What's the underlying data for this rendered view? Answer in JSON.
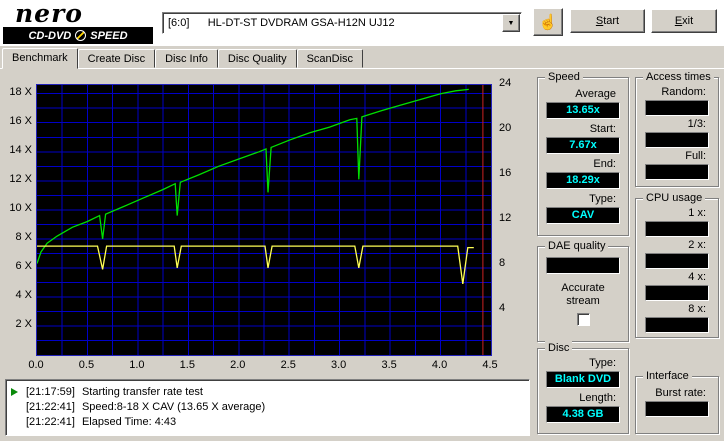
{
  "header": {
    "logo_name": "nero",
    "logo_cd_dvd": "CD-DVD",
    "logo_speed": "SPEED",
    "drive_select_value": "[6:0]      HL-DT-ST DVDRAM GSA-H12N UJ12",
    "start_button": "Start",
    "exit_button": "Exit"
  },
  "icons": {
    "dropdown_arrow": "▼",
    "hand": "☝"
  },
  "tabs": {
    "items": [
      "Benchmark",
      "Create Disc",
      "Disc Info",
      "Disc Quality",
      "ScanDisc"
    ],
    "active": "Benchmark"
  },
  "panels": {
    "speed": {
      "title": "Speed",
      "average_label": "Average",
      "average_value": "13.65x",
      "start_label": "Start:",
      "start_value": "7.67x",
      "end_label": "End:",
      "end_value": "18.29x",
      "type_label": "Type:",
      "type_value": "CAV"
    },
    "access_times": {
      "title": "Access times",
      "random_label": "Random:",
      "random_value": "",
      "one_third_label": "1/3:",
      "one_third_value": "",
      "full_label": "Full:",
      "full_value": ""
    },
    "cpu_usage": {
      "title": "CPU usage",
      "labels": [
        "1 x:",
        "2 x:",
        "4 x:",
        "8 x:"
      ],
      "values": [
        "",
        "",
        "",
        ""
      ]
    },
    "dae_quality": {
      "title": "DAE quality",
      "value": "",
      "accurate_stream_label": "Accurate stream",
      "checkbox_checked": false
    },
    "disc": {
      "title": "Disc",
      "type_label": "Type:",
      "type_value": "Blank DVD",
      "length_label": "Length:",
      "length_value": "4.38 GB"
    },
    "interface": {
      "title": "Interface",
      "burst_label": "Burst rate:",
      "burst_value": ""
    }
  },
  "log": {
    "lines": [
      {
        "time": "[21:17:59]",
        "text": "Starting transfer rate test"
      },
      {
        "time": "[21:22:41]",
        "text": "Speed:8-18 X CAV (13.65 X average)"
      },
      {
        "time": "[21:22:41]",
        "text": "Elapsed Time: 4:43"
      }
    ]
  },
  "colors": {
    "window_grey": "#d4d0c8",
    "value_cyan": "#00ffff",
    "transfer_green": "#00e000",
    "rotation_yellow": "#ffff55",
    "grid_blue": "#0000c8",
    "end_marker_red": "#cc2222"
  },
  "chart_data": {
    "type": "line",
    "x_range": [
      0,
      4.5
    ],
    "y_left_range": [
      0,
      18.6
    ],
    "y_right_range": [
      0,
      24
    ],
    "x_tick_values": [
      0,
      0.5,
      1.0,
      1.5,
      2.0,
      2.5,
      3.0,
      3.5,
      4.0,
      4.5
    ],
    "x_tick_labels": [
      "0.0",
      "0.5",
      "1.0",
      "1.5",
      "2.0",
      "2.5",
      "3.0",
      "3.5",
      "4.0",
      "4.5"
    ],
    "y_left_tick_values": [
      18,
      16,
      14,
      12,
      10,
      8,
      6,
      4,
      2
    ],
    "y_left_tick_labels": [
      "18 X",
      "16 X",
      "14 X",
      "12 X",
      "10 X",
      "8 X",
      "6 X",
      "4 X",
      "2 X"
    ],
    "y_right_tick_values": [
      24,
      20,
      16,
      12,
      8,
      4
    ],
    "y_right_tick_labels": [
      "24",
      "20",
      "16",
      "12",
      "8",
      "4"
    ],
    "grid": {
      "x_step": 0.25,
      "y_step": 1,
      "color": "#0000c8"
    },
    "end_marker_x": 4.42,
    "end_marker_color": "#cc2222",
    "series": [
      {
        "name": "transfer-rate",
        "color": "#00e000",
        "points": [
          [
            0.0,
            6.3
          ],
          [
            0.04,
            7.1
          ],
          [
            0.1,
            7.7
          ],
          [
            0.2,
            8.2
          ],
          [
            0.35,
            8.8
          ],
          [
            0.5,
            9.2
          ],
          [
            0.62,
            9.6
          ],
          [
            0.65,
            8.0
          ],
          [
            0.68,
            9.7
          ],
          [
            0.85,
            10.2
          ],
          [
            1.05,
            10.8
          ],
          [
            1.25,
            11.4
          ],
          [
            1.37,
            11.8
          ],
          [
            1.39,
            9.6
          ],
          [
            1.42,
            11.9
          ],
          [
            1.6,
            12.4
          ],
          [
            1.8,
            13.0
          ],
          [
            2.0,
            13.5
          ],
          [
            2.2,
            14.0
          ],
          [
            2.27,
            14.2
          ],
          [
            2.29,
            11.2
          ],
          [
            2.32,
            14.3
          ],
          [
            2.5,
            14.8
          ],
          [
            2.7,
            15.3
          ],
          [
            2.9,
            15.7
          ],
          [
            3.1,
            16.2
          ],
          [
            3.17,
            16.3
          ],
          [
            3.19,
            12.1
          ],
          [
            3.22,
            16.4
          ],
          [
            3.4,
            16.8
          ],
          [
            3.6,
            17.2
          ],
          [
            3.8,
            17.6
          ],
          [
            4.0,
            18.0
          ],
          [
            4.15,
            18.2
          ],
          [
            4.28,
            18.3
          ]
        ]
      },
      {
        "name": "rotation-speed",
        "color": "#ffff55",
        "points": [
          [
            0.0,
            7.5
          ],
          [
            0.6,
            7.5
          ],
          [
            0.65,
            5.9
          ],
          [
            0.69,
            7.5
          ],
          [
            1.36,
            7.5
          ],
          [
            1.39,
            6.0
          ],
          [
            1.43,
            7.5
          ],
          [
            2.26,
            7.5
          ],
          [
            2.29,
            6.0
          ],
          [
            2.33,
            7.5
          ],
          [
            3.15,
            7.5
          ],
          [
            3.19,
            6.0
          ],
          [
            3.23,
            7.5
          ],
          [
            4.17,
            7.5
          ],
          [
            4.22,
            4.9
          ],
          [
            4.27,
            7.4
          ],
          [
            4.33,
            7.4
          ]
        ]
      }
    ]
  }
}
